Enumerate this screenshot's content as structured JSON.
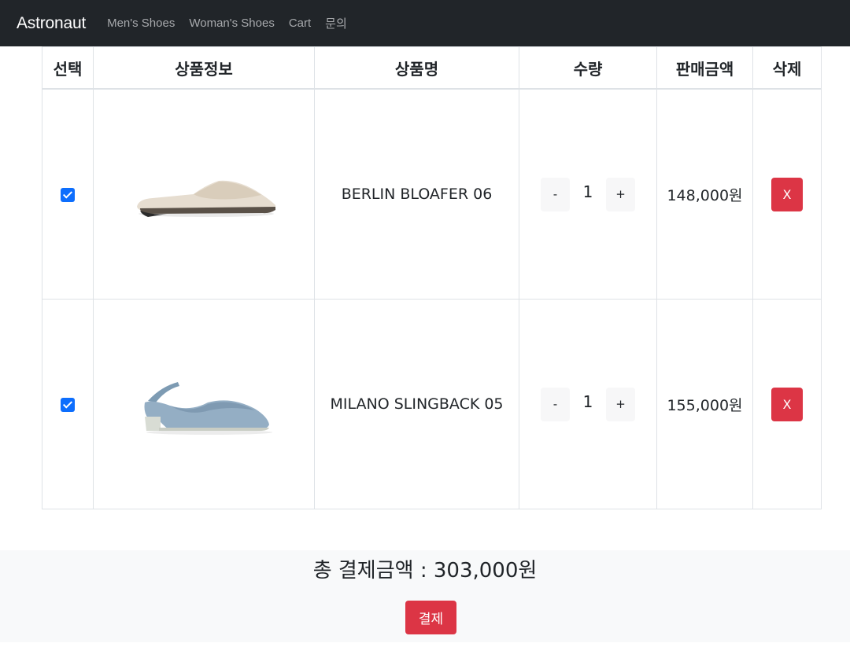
{
  "navbar": {
    "brand": "Astronaut",
    "links": [
      "Men's Shoes",
      "Woman's Shoes",
      "Cart",
      "문의"
    ]
  },
  "table": {
    "headers": [
      "선택",
      "상품정보",
      "상품명",
      "수량",
      "판매금액",
      "삭제"
    ],
    "rows": [
      {
        "checked": true,
        "name": "BERLIN BLOAFER 06",
        "qty": "1",
        "minus": "-",
        "plus": "+",
        "price": "148,000원",
        "delete": "X"
      },
      {
        "checked": true,
        "name": "MILANO SLINGBACK 05",
        "qty": "1",
        "minus": "-",
        "plus": "+",
        "price": "155,000원",
        "delete": "X"
      }
    ]
  },
  "summary": {
    "total": "총 결제금액 : 303,000원",
    "pay_button": "결제"
  },
  "colors": {
    "navbar": "#212529",
    "danger": "#dc3545",
    "checkbox": "#0d6efd",
    "summary_bg": "#f8f9fa"
  }
}
